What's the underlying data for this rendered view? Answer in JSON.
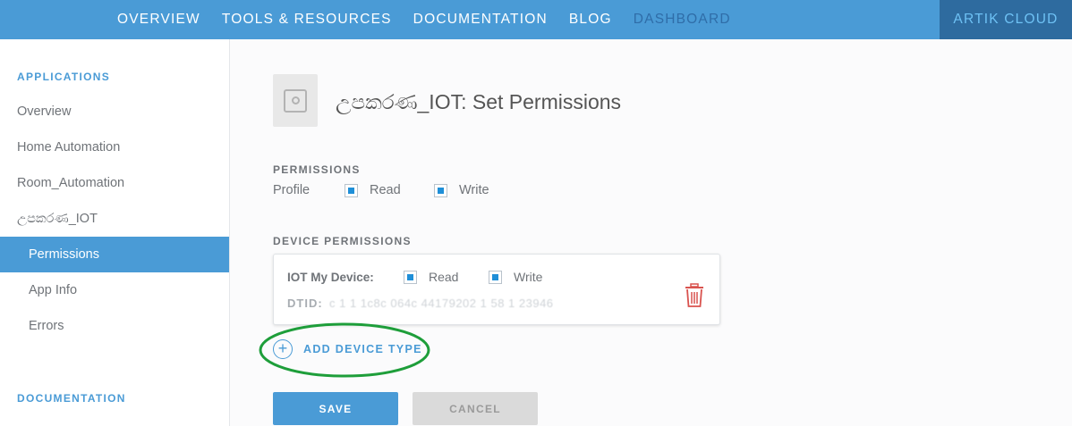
{
  "topnav": {
    "items": [
      "OVERVIEW",
      "TOOLS & RESOURCES",
      "DOCUMENTATION",
      "BLOG",
      "DASHBOARD"
    ],
    "active": "DASHBOARD",
    "brand": "ARTIK CLOUD"
  },
  "sidebar": {
    "applications_heading": "APPLICATIONS",
    "items": [
      {
        "label": "Overview"
      },
      {
        "label": "Home Automation"
      },
      {
        "label": "Room_Automation"
      },
      {
        "label": "උපකරණ_IOT"
      },
      {
        "label": "Permissions",
        "active": true
      },
      {
        "label": "App Info"
      },
      {
        "label": "Errors"
      }
    ],
    "documentation_heading": "DOCUMENTATION"
  },
  "main": {
    "title": "උපකරණ_IOT: Set Permissions",
    "permissions": {
      "heading": "PERMISSIONS",
      "profile_label": "Profile",
      "read_label": "Read",
      "read_checked": true,
      "write_label": "Write",
      "write_checked": true
    },
    "device_permissions": {
      "heading": "DEVICE PERMISSIONS",
      "devices": [
        {
          "name": "IOT My Device:",
          "read_label": "Read",
          "read_checked": true,
          "write_label": "Write",
          "write_checked": true,
          "dtid_label": "DTID:",
          "dtid_value": "c 1 1 1c8c 064c 44179202 1 58 1 23946"
        }
      ]
    },
    "add_device_type_label": "ADD DEVICE TYPE",
    "save_label": "SAVE",
    "cancel_label": "CANCEL"
  },
  "colors": {
    "accent": "#4a9bd6",
    "brand_bg": "#2e6b9f",
    "checkbox_fill": "#1f8fd8",
    "trash": "#d9534f",
    "highlight_ring": "#1e9e3a"
  }
}
